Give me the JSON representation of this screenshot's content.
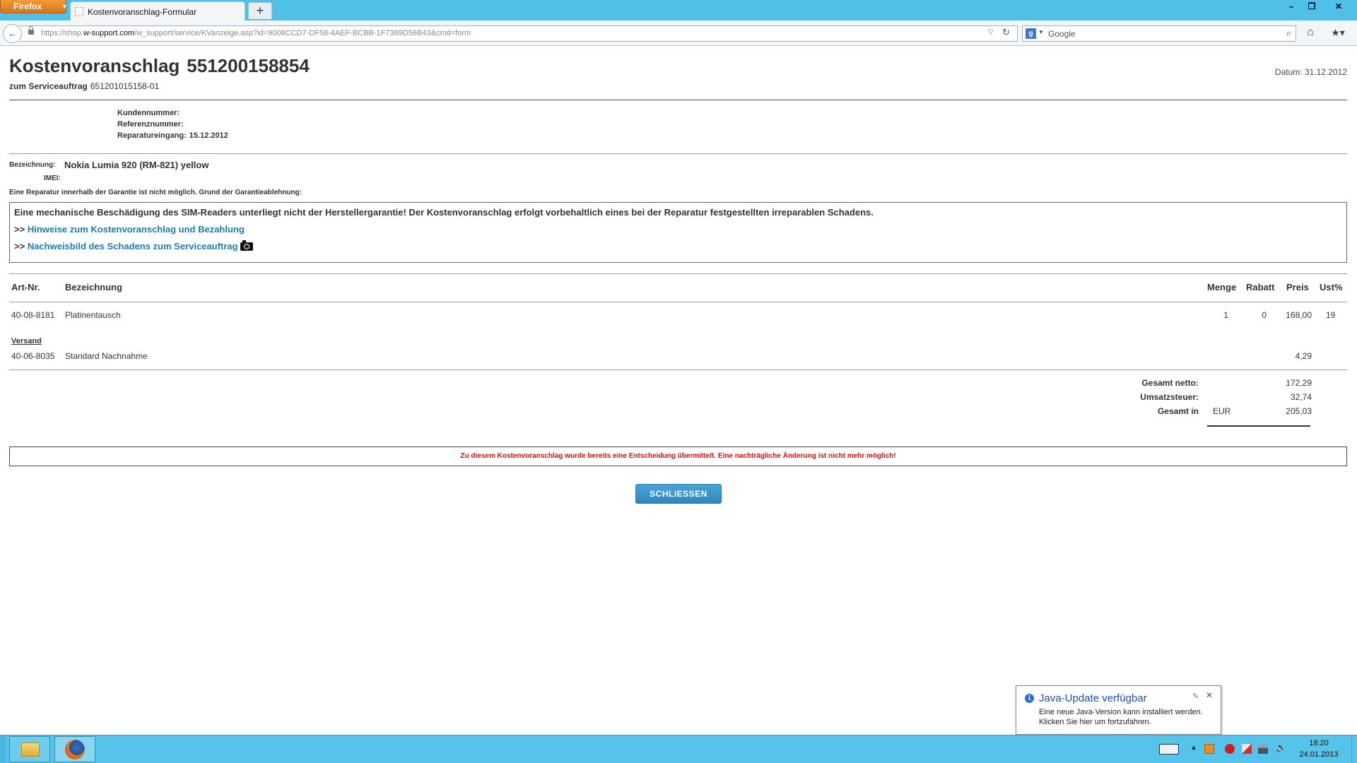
{
  "browser": {
    "app_button": "Firefox",
    "tab_title": "Kostenvoranschlag-Formular",
    "new_tab": "+",
    "url_prefix": "https://shop.",
    "url_domain": "w-support.com",
    "url_path": "/w_support/service/KVanzeige.asp?id=9008CCD7-DF58-4AEF-BCBB-1F7389D56B43&cmd=form",
    "search_engine_letter": "g",
    "search_placeholder": "Google",
    "window_min": "–",
    "window_max": "❐",
    "window_close": "✕",
    "icons": [
      "firefox-menu",
      "tab-favicon",
      "back-arrow",
      "lock",
      "url-dropdown",
      "reload",
      "search-engine",
      "magnifier",
      "home",
      "bookmarks-star"
    ]
  },
  "document": {
    "title": "Kostenvoranschlag",
    "number": "551200158854",
    "subtitle_label": "zum Serviceauftrag",
    "subtitle_number": "651201015158-01",
    "date_label": "Datum:",
    "date_value": "31.12.2012",
    "meta": {
      "kundennummer_label": "Kundennummer:",
      "kundennummer_value": "",
      "referenznummer_label": "Referenznummer:",
      "referenznummer_value": "",
      "reparatureingang_label": "Reparatureingang:",
      "reparatureingang_value": "15.12.2012"
    },
    "bezeichnung_label": "Bezeichnung:",
    "bezeichnung_value": "Nokia Lumia 920 (RM-821) yellow",
    "imei_label": "IMEI:",
    "guarantee_note": "Eine Reparatur innerhalb der Garantie ist nicht möglich. Grund der Garantieablehnung:",
    "reason_text": "Eine mechanische Beschädigung des SIM-Readers unterliegt nicht der Herstellergarantie! Der Kostenvoranschlag erfolgt vorbehaltlich eines bei der Reparatur festgestellten irreparablen Schadens.",
    "link_prefix": ">>",
    "link_hinweise": "Hinweise zum Kostenvoranschlag und Bezahlung",
    "link_nachweisbild": "Nachweisbild des Schadens zum Serviceauftrag"
  },
  "table": {
    "headers": {
      "artnr": "Art-Nr.",
      "bezeichnung": "Bezeichnung",
      "menge": "Menge",
      "rabatt": "Rabatt",
      "preis": "Preis",
      "ust": "Ust%"
    },
    "rows": [
      {
        "artnr": "40-08-8181",
        "bezeichnung": "Platinentausch",
        "menge": "1",
        "rabatt": "0",
        "preis": "168,00",
        "ust": "19"
      }
    ],
    "versand_label": "Versand",
    "versand_row": {
      "artnr": "40-06-8035",
      "bezeichnung": "Standard Nachnahme",
      "preis": "4,29"
    }
  },
  "totals": {
    "netto_label": "Gesamt netto:",
    "netto_value": "172,29",
    "ust_label": "Umsatzsteuer:",
    "ust_value": "32,74",
    "gesamt_label": "Gesamt in",
    "currency": "EUR",
    "gesamt_value": "205,03"
  },
  "decision_message": "Zu diesem Kostenvoranschlag wurde bereits eine Entscheidung übermittelt. Eine nachträgliche Änderung ist nicht mehr möglich!",
  "close_button": "SCHLIESSEN",
  "java_popup": {
    "info_glyph": "i",
    "title": "Java-Update verfügbar",
    "line1": "Eine neue Java-Version kann installiert werden.",
    "line2": "Klicken Sie hier um fortzufahren.",
    "pin": "✎",
    "close": "✕"
  },
  "taskbar": {
    "apps": [
      "file-explorer",
      "firefox"
    ],
    "tray_arrow": "▲",
    "time": "18:20",
    "date": "24.01.2013"
  }
}
